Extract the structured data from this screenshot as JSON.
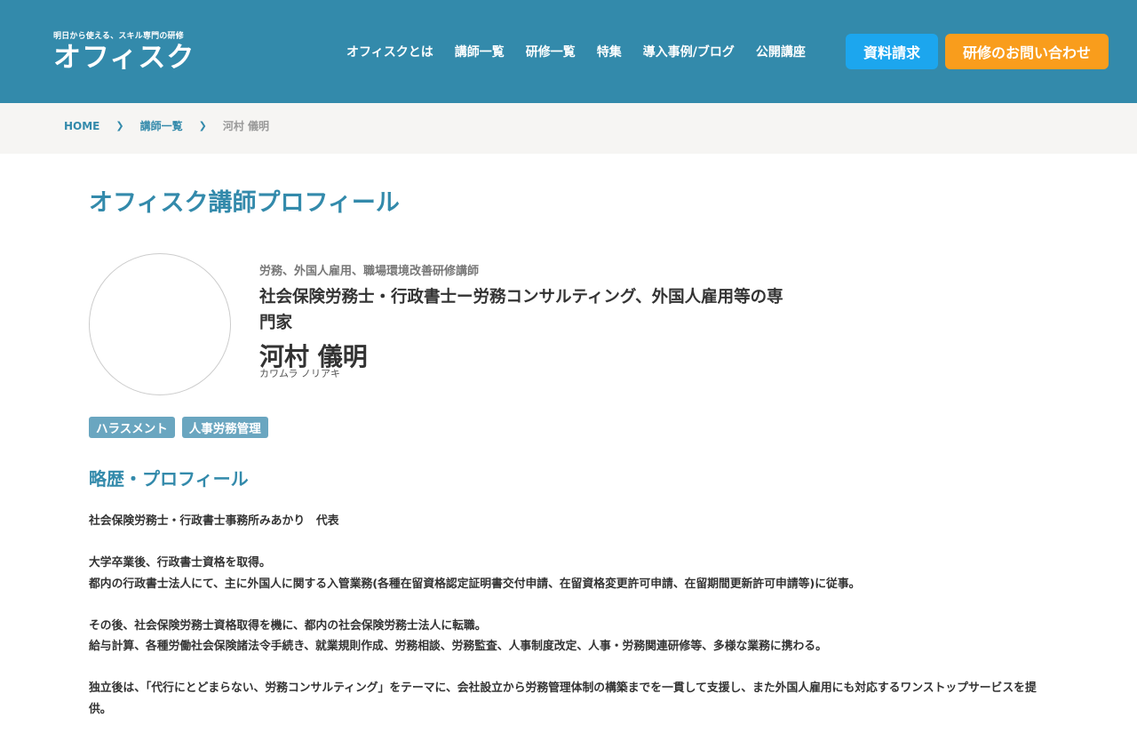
{
  "header": {
    "logo_tagline": "明日から使える、スキル専門の研修",
    "logo_text": "オフィスク",
    "nav": [
      "オフィスクとは",
      "講師一覧",
      "研修一覧",
      "特集",
      "導入事例/ブログ",
      "公開講座"
    ],
    "btn_document": "資料請求",
    "btn_contact": "研修のお問い合わせ"
  },
  "breadcrumb": {
    "home": "HOME",
    "list": "講師一覧",
    "current": "河村 儀明"
  },
  "page_title": "オフィスク講師プロフィール",
  "profile": {
    "role": "労務、外国人雇用、職場環境改善研修講師",
    "headline": "社会保険労務士・行政書士ー労務コンサルティング、外国人雇用等の専門家",
    "name": "河村 儀明",
    "kana": "カワムラ ノリアキ",
    "tags": [
      "ハラスメント",
      "人事労務管理"
    ]
  },
  "section_title": "略歴・プロフィール",
  "bio": [
    [
      "社会保険労務士・行政書士事務所みあかり　代表"
    ],
    [
      "大学卒業後、行政書士資格を取得。",
      "都内の行政書士法人にて、主に外国人に関する入管業務(各種在留資格認定証明書交付申請、在留資格変更許可申請、在留期間更新許可申請等)に従事。"
    ],
    [
      "その後、社会保険労務士資格取得を機に、都内の社会保険労務士法人に転職。",
      "給与計算、各種労働社会保険諸法令手続き、就業規則作成、労務相談、労務監査、人事制度改定、人事・労務関連研修等、多様な業務に携わる。"
    ],
    [
      "独立後は、「代行にとどまらない、労務コンサルティング」をテーマに、会社設立から労務管理体制の構築までを一貫して支援し、また外国人雇用にも対応するワンストップサービスを提供。"
    ]
  ]
}
